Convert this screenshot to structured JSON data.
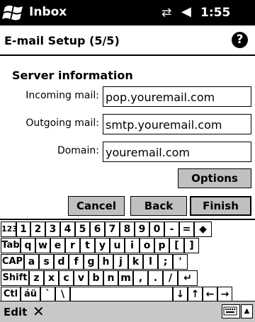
{
  "status_bar": {
    "app_title": "Inbox",
    "time": "1:55",
    "connectivity_icon": "connectivity-icon",
    "volume_icon": "speaker-icon"
  },
  "header": {
    "title": "E-mail Setup (5/5)",
    "help": "?"
  },
  "section_title": "Server information",
  "fields": {
    "incoming": {
      "label": "Incoming mail:",
      "value": "pop.youremail.com"
    },
    "outgoing": {
      "label": "Outgoing mail:",
      "value": "smtp.youremail.com"
    },
    "domain": {
      "label": "Domain:",
      "value": "youremail.com"
    }
  },
  "buttons": {
    "options": "Options",
    "cancel": "Cancel",
    "back": "Back",
    "finish": "Finish"
  },
  "keyboard": {
    "rows": [
      [
        "123",
        "1",
        "2",
        "3",
        "4",
        "5",
        "6",
        "7",
        "8",
        "9",
        "0",
        "-",
        "=",
        "◆"
      ],
      [
        "Tab",
        "q",
        "w",
        "e",
        "r",
        "t",
        "y",
        "u",
        "i",
        "o",
        "p",
        "[",
        "]"
      ],
      [
        "CAP",
        "a",
        "s",
        "d",
        "f",
        "g",
        "h",
        "j",
        "k",
        "l",
        ";",
        "'"
      ],
      [
        "Shift",
        "z",
        "x",
        "c",
        "v",
        "b",
        "n",
        "m",
        ",",
        ".",
        "/",
        "↵"
      ],
      [
        "Ctl",
        "áü",
        "`",
        "\\",
        "",
        "↓",
        "↑",
        "←",
        "→"
      ]
    ]
  },
  "menubar": {
    "edit": "Edit",
    "close": "✕"
  }
}
